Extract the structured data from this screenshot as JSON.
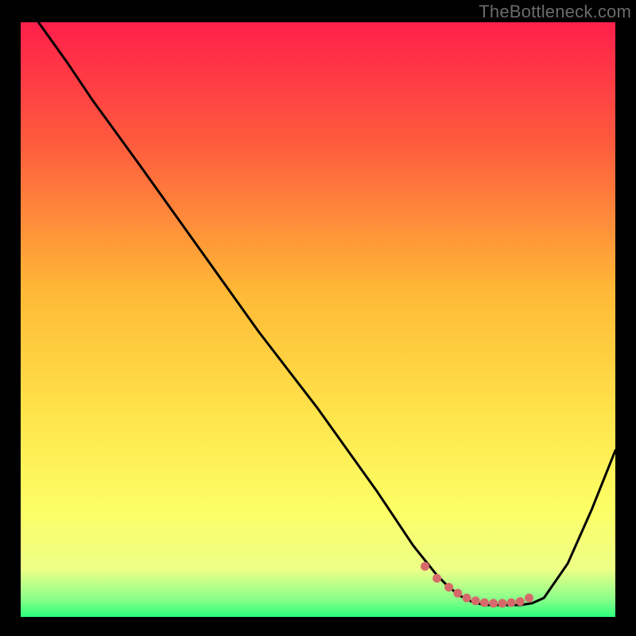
{
  "watermark": "TheBottleneck.com",
  "chart_data": {
    "type": "line",
    "title": "",
    "xlabel": "",
    "ylabel": "",
    "xlim": [
      0,
      100
    ],
    "ylim": [
      0,
      100
    ],
    "grid": false,
    "gradient_stops": [
      {
        "offset": 0.0,
        "color": "#ff1f4b"
      },
      {
        "offset": 0.2,
        "color": "#ff5a3e"
      },
      {
        "offset": 0.45,
        "color": "#ffb836"
      },
      {
        "offset": 0.65,
        "color": "#ffe24a"
      },
      {
        "offset": 0.82,
        "color": "#fdff66"
      },
      {
        "offset": 0.92,
        "color": "#edff87"
      },
      {
        "offset": 0.97,
        "color": "#8aff8a"
      },
      {
        "offset": 1.0,
        "color": "#2cff7a"
      }
    ],
    "series": [
      {
        "name": "bottleneck-curve",
        "color": "#000000",
        "x": [
          3,
          8,
          12,
          20,
          30,
          40,
          50,
          60,
          66,
          70,
          72,
          74,
          76,
          78,
          80,
          82,
          83,
          84,
          86,
          88,
          92,
          96,
          100
        ],
        "y": [
          100,
          93,
          87,
          76,
          62,
          48,
          35,
          21,
          12,
          7,
          5,
          3.5,
          2.5,
          2,
          2,
          2,
          2,
          2,
          2.3,
          3.2,
          9,
          18,
          28
        ]
      }
    ],
    "markers": {
      "name": "trough-markers",
      "color": "#d66a6a",
      "radius": 5.5,
      "x": [
        68,
        70,
        72,
        73.5,
        75,
        76.5,
        78,
        79.5,
        81,
        82.5,
        84,
        85.5
      ],
      "y": [
        8.5,
        6.5,
        5,
        4,
        3.2,
        2.7,
        2.4,
        2.3,
        2.3,
        2.4,
        2.6,
        3.2
      ]
    }
  }
}
